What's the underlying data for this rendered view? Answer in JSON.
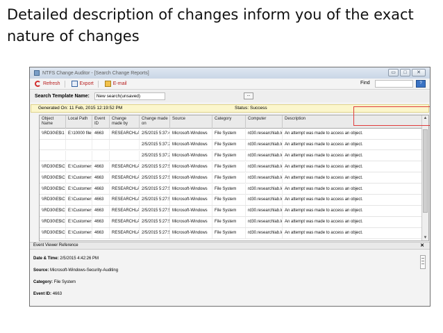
{
  "slide": {
    "title": "Detailed description of changes inform you of the exact nature of changes"
  },
  "window": {
    "title": "NTFS Change Auditor - [Search Change Reports]",
    "controls": {
      "minimize": "▭",
      "maximize": "□",
      "close": "✕"
    }
  },
  "toolbar": {
    "refresh_label": "Refresh",
    "export_label": "Export",
    "email_label": "E-mail",
    "find_label": "Find",
    "find_button": "?"
  },
  "search": {
    "label": "Search Template Name:",
    "value": "New search(unsaved)",
    "browse_button": "..."
  },
  "info": {
    "generated": "Generated On: 11 Feb, 2015 12:19:52 PM",
    "status": "Status: Success"
  },
  "grid": {
    "columns": [
      "Object Name",
      "Local Path",
      "Event ID",
      "Change made by",
      "Change made on",
      "Source",
      "Category",
      "Computer",
      "Description"
    ],
    "rows": [
      [
        "\\\\RD30\\E$\\1",
        "E:\\10000 files -",
        "4663",
        "RESEARCHLAB\\ad",
        "2/5/2015 5:37:41 PM",
        "Microsoft-Windows",
        "File System",
        "rd30.researchlab.lo",
        "An attempt was made to access an object."
      ],
      [
        "",
        "",
        "",
        "",
        "2/5/2015 5:37:25 PM",
        "Microsoft-Windows",
        "File System",
        "rd30.researchlab.lo",
        "An attempt was made to access an object."
      ],
      [
        "",
        "",
        "",
        "",
        "2/5/2015 5:37:24 PM",
        "Microsoft-Windows",
        "File System",
        "rd30.researchlab.lo",
        "An attempt was made to access an object."
      ],
      [
        "\\\\RD30\\E$\\C",
        "E:\\Customers [",
        "4663",
        "RESEARCHLAB\\ad",
        "2/5/2015 5:27:52 PM",
        "Microsoft-Windows",
        "File System",
        "rd30.researchlab.lo",
        "An attempt was made to access an object."
      ],
      [
        "\\\\RD30\\E$\\C",
        "E:\\Customers [",
        "4663",
        "RESEARCHLAB\\ad",
        "2/5/2015 5:27:52 PM",
        "Microsoft-Windows",
        "File System",
        "rd30.researchlab.lo",
        "An attempt was made to access an object."
      ],
      [
        "\\\\RD30\\E$\\C",
        "E:\\Customers [",
        "4663",
        "RESEARCHLAB\\ad",
        "2/5/2015 5:27:52 PM",
        "Microsoft-Windows",
        "File System",
        "rd30.researchlab.lo",
        "An attempt was made to access an object."
      ],
      [
        "\\\\RD30\\E$\\C",
        "E:\\Customers [",
        "4663",
        "RESEARCHLAB\\ad",
        "2/5/2015 5:27:52 PM",
        "Microsoft-Windows",
        "File System",
        "rd30.researchlab.lo",
        "An attempt was made to access an object."
      ],
      [
        "\\\\RD30\\E$\\C",
        "E:\\Customers [",
        "4663",
        "RESEARCHLAB\\ad",
        "2/5/2015 5:27:52 PM",
        "Microsoft-Windows",
        "File System",
        "rd30.researchlab.lo",
        "An attempt was made to access an object."
      ],
      [
        "\\\\RD30\\E$\\C",
        "E:\\Customers [",
        "4663",
        "RESEARCHLAB\\ad",
        "2/5/2015 5:27:52 PM",
        "Microsoft-Windows",
        "File System",
        "rd30.researchlab.lo",
        "An attempt was made to access an object."
      ],
      [
        "\\\\RD30\\E$\\C",
        "E:\\Customers [",
        "4663",
        "RESEARCHLAB\\ad",
        "2/5/2015 5:27:52 PM",
        "Microsoft-Windows",
        "File System",
        "rd30.researchlab.lo",
        "An attempt was made to access an object."
      ]
    ]
  },
  "event_viewer": {
    "title": "Event Viewer Reference",
    "close": "✕",
    "datetime_label": "Date & Time:",
    "datetime_value": "2/5/2015 4:42:26 PM",
    "source_label": "Source:",
    "source_value": "Microsoft-Windows-Security-Auditing",
    "category_label": "Category:",
    "category_value": "File System",
    "eventid_label": "Event ID:",
    "eventid_value": "4663"
  },
  "colors": {
    "highlight": "#e03b3b",
    "info_bar": "#fbf6cc",
    "toolbar_text": "#b71c1c"
  }
}
